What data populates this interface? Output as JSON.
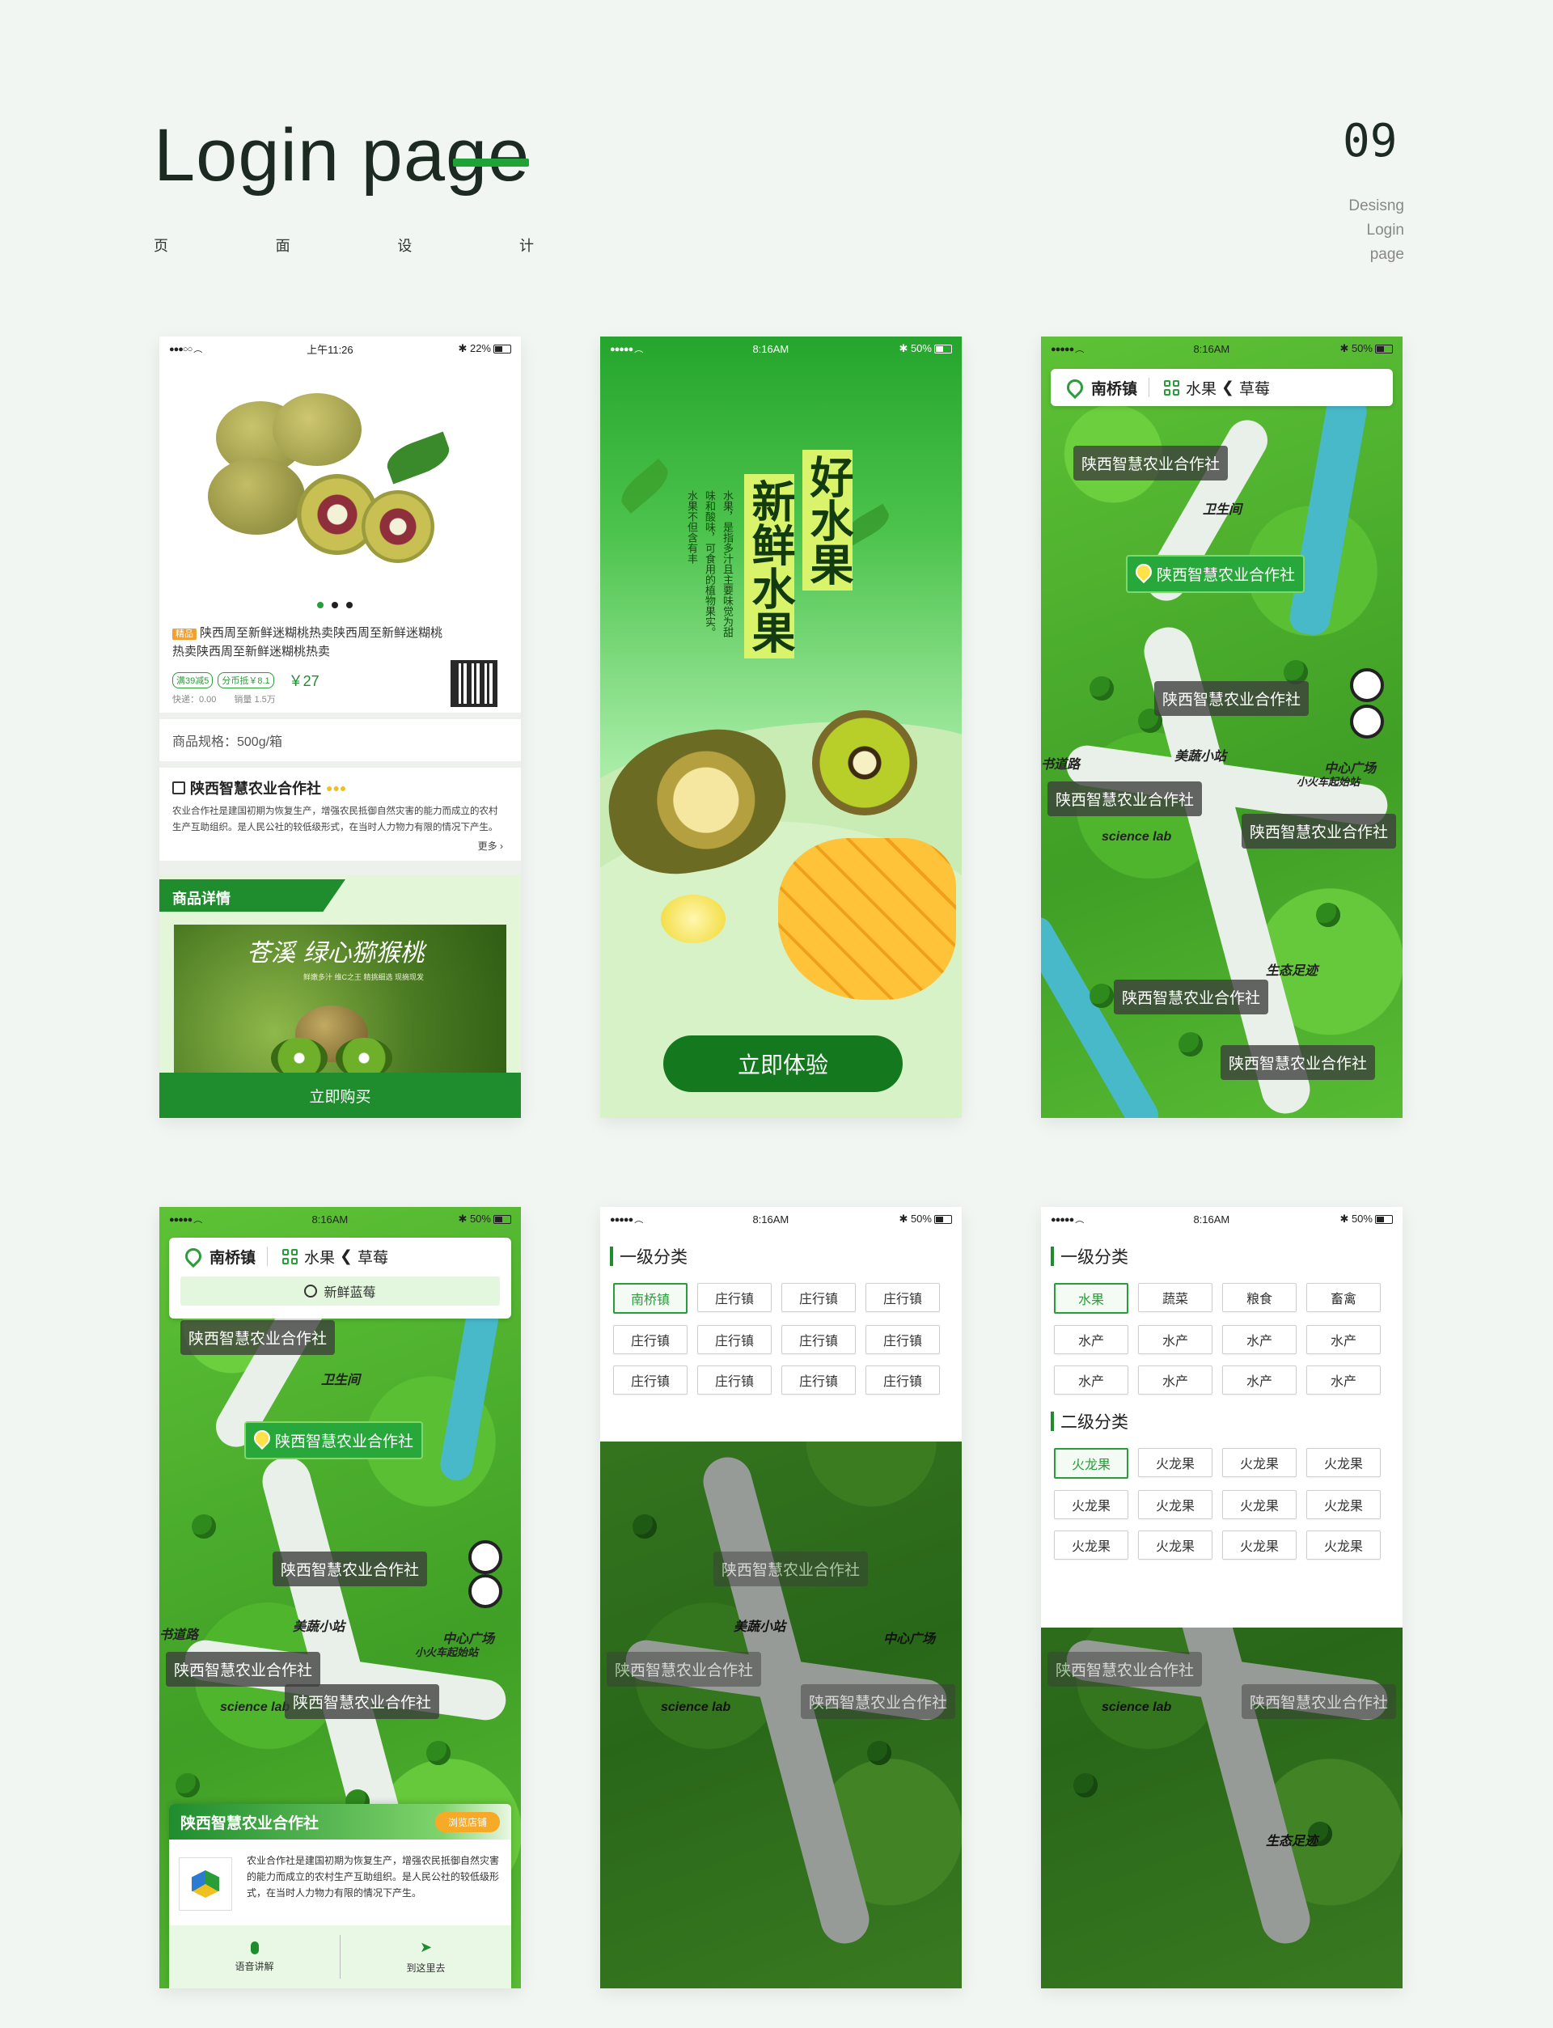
{
  "header": {
    "title": "Login page",
    "subtitle_chars": [
      "页",
      "面",
      "设",
      "计"
    ],
    "page_number": "09",
    "side_note": [
      "Desisng",
      "Login",
      "page"
    ]
  },
  "colors": {
    "brand_green": "#1f8d2e",
    "accent_green": "#2a9d3a",
    "background": "#f1f6f2"
  },
  "screen1": {
    "status": {
      "time": "上午11:26",
      "battery": "22%"
    },
    "product_tag": "精品",
    "product_title": "陕西周至新鲜迷糊桃热卖陕西周至新鲜迷糊桃热卖陕西周至新鲜迷糊桃热卖",
    "coupons": [
      "满39减5",
      "分币抵￥8.1"
    ],
    "price": "￥27",
    "delivery": "快递：0.00",
    "sales": "销量 1.5万",
    "spec": "商品规格：500g/箱",
    "coop_name": "陕西智慧农业合作社",
    "coop_desc": "农业合作社是建国初期为恢复生产，增强农民抵御自然灾害的能力而成立的农村生产互助组织。是人民公社的较低级形式，在当时人力物力有限的情况下产生。",
    "more": "更多",
    "details_tab": "商品详情",
    "banner_title": "苍溪 绿心猕猴桃",
    "banner_sub": "鲜嫩多汁  维C之王  精挑细选  现摘现发",
    "buy_button": "立即购买"
  },
  "screen2": {
    "status": {
      "time": "8:16AM",
      "battery": "50%"
    },
    "headline_1": "好水果",
    "headline_2": "新鲜水果",
    "text_col_1": "水果，是指多汁且主要味觉为甜",
    "text_col_2": "味和酸味，可食用的植物果实。",
    "text_col_3": "水果不但含有丰",
    "cta": "立即体验"
  },
  "map_common": {
    "status": {
      "time": "8:16AM",
      "battery": "50%"
    },
    "town": "南桥镇",
    "category": "水果",
    "sub_category": "草莓",
    "coop_label": "陕西智慧农业合作社",
    "map_labels": [
      "卫生间",
      "美蔬小站",
      "中心广场",
      "小火车起始站",
      "science lab",
      "书道路",
      "生态足迹"
    ]
  },
  "screen4": {
    "search_placeholder": "新鲜蓝莓",
    "card_title": "陕西智慧农业合作社",
    "card_button": "浏览店铺",
    "card_desc": "农业合作社是建国初期为恢复生产，增强农民抵御自然灾害的能力而成立的农村生产互助组织。是人民公社的较低级形式，在当时人力物力有限的情况下产生。",
    "action_voice": "语音讲解",
    "action_go": "到这里去"
  },
  "screen5": {
    "section_1": "一级分类",
    "chips": [
      "南桥镇",
      "庄行镇",
      "庄行镇",
      "庄行镇",
      "庄行镇",
      "庄行镇",
      "庄行镇",
      "庄行镇",
      "庄行镇",
      "庄行镇",
      "庄行镇",
      "庄行镇"
    ]
  },
  "screen6": {
    "section_1": "一级分类",
    "chips_1": [
      "水果",
      "蔬菜",
      "粮食",
      "畜禽",
      "水产",
      "水产",
      "水产",
      "水产",
      "水产",
      "水产",
      "水产",
      "水产"
    ],
    "section_2": "二级分类",
    "chips_2": [
      "火龙果",
      "火龙果",
      "火龙果",
      "火龙果",
      "火龙果",
      "火龙果",
      "火龙果",
      "火龙果",
      "火龙果",
      "火龙果",
      "火龙果",
      "火龙果"
    ]
  }
}
